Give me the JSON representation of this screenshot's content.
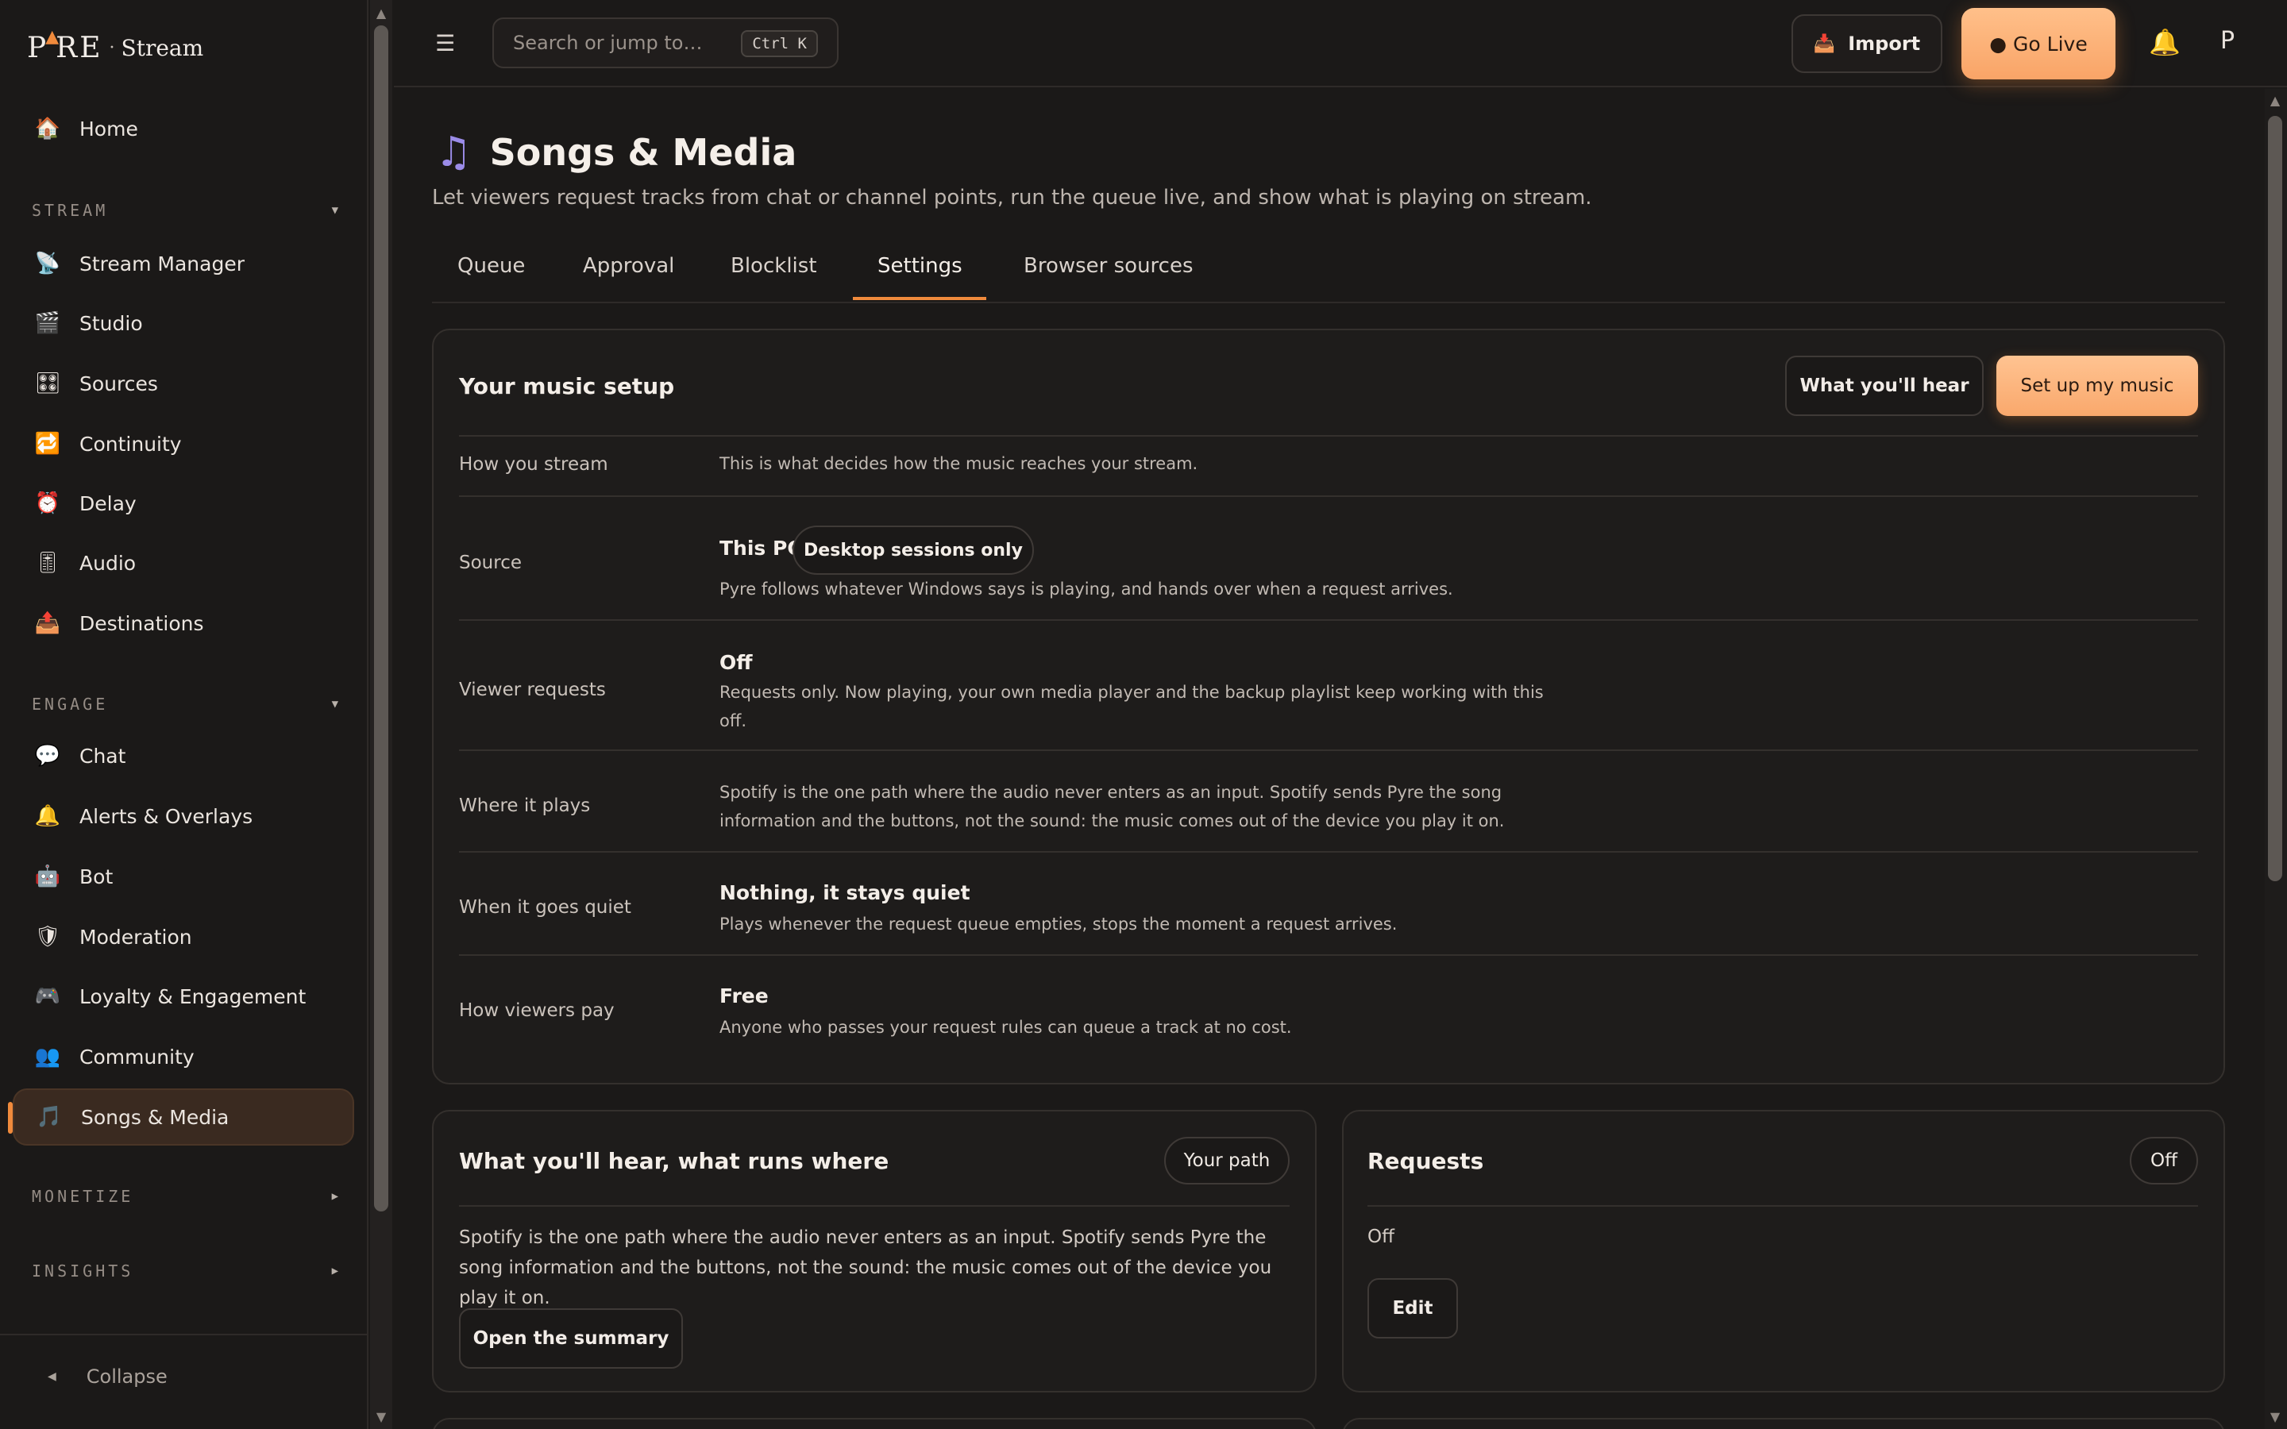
{
  "brand": {
    "name": "PYRE",
    "separator": "·",
    "product": "Stream"
  },
  "sidebar": {
    "home": {
      "label": "Home",
      "icon": "home-icon"
    },
    "sections": {
      "stream": "STREAM",
      "engage": "ENGAGE",
      "monetize": "MONETIZE",
      "insights": "INSIGHTS"
    },
    "stream_items": [
      {
        "label": "Stream Manager",
        "icon": "satellite-dish-icon"
      },
      {
        "label": "Studio",
        "icon": "clapperboard-icon"
      },
      {
        "label": "Sources",
        "icon": "sources-grid-icon"
      },
      {
        "label": "Continuity",
        "icon": "repeat-icon"
      },
      {
        "label": "Delay",
        "icon": "alarm-clock-icon"
      },
      {
        "label": "Audio",
        "icon": "audio-slider-icon"
      },
      {
        "label": "Destinations",
        "icon": "outbox-icon"
      }
    ],
    "engage_items": [
      {
        "label": "Chat",
        "icon": "speech-bubble-icon"
      },
      {
        "label": "Alerts & Overlays",
        "icon": "bell-icon"
      },
      {
        "label": "Bot",
        "icon": "robot-icon"
      },
      {
        "label": "Moderation",
        "icon": "shield-icon"
      },
      {
        "label": "Loyalty & Engagement",
        "icon": "gamepad-icon"
      },
      {
        "label": "Community",
        "icon": "people-icon"
      },
      {
        "label": "Songs & Media",
        "icon": "music-note-icon"
      }
    ],
    "collapse": "Collapse"
  },
  "topbar": {
    "search_placeholder": "Search or jump to…",
    "search_shortcut": "Ctrl K",
    "import_label": "Import",
    "go_live_label": "● Go Live",
    "avatar_initial": "P"
  },
  "page": {
    "title": "Songs & Media",
    "description": "Let viewers request tracks from chat or channel points, run the queue live, and show what is playing on stream.",
    "tabs": [
      "Queue",
      "Approval",
      "Blocklist",
      "Settings",
      "Browser sources"
    ],
    "active_tab": "Settings"
  },
  "setup_card": {
    "title": "Your music setup",
    "what_youll_hear_btn": "What you'll hear",
    "setup_btn": "Set up my music",
    "rows": {
      "how_you_stream": {
        "label": "How you stream",
        "text": "This is what decides how the music reaches your stream."
      },
      "source": {
        "label": "Source",
        "value": "This PC",
        "chip": "Desktop sessions only",
        "text": "Pyre follows whatever Windows says is playing, and hands over when a request arrives."
      },
      "viewer_requests": {
        "label": "Viewer requests",
        "value": "Off",
        "text": "Requests only. Now playing, your own media player and the backup playlist keep working with this off."
      },
      "where_it_plays": {
        "label": "Where it plays",
        "text": "Spotify is the one path where the audio never enters as an input. Spotify sends Pyre the song information and the buttons, not the sound: the music comes out of the device you play it on."
      },
      "when_quiet": {
        "label": "When it goes quiet",
        "value": "Nothing, it stays quiet",
        "text": "Plays whenever the request queue empties, stops the moment a request arrives."
      },
      "how_pay": {
        "label": "How viewers pay",
        "value": "Free",
        "text": "Anyone who passes your request rules can queue a track at no cost."
      }
    }
  },
  "hear_card": {
    "title": "What you'll hear, what runs where",
    "pill": "Your path",
    "text": "Spotify is the one path where the audio never enters as an input. Spotify sends Pyre the song information and the buttons, not the sound: the music comes out of the device you play it on.",
    "button": "Open the summary"
  },
  "requests_card": {
    "title": "Requests",
    "pill": "Off",
    "status": "Off",
    "button": "Edit"
  },
  "colors": {
    "background": "#1b1918",
    "accent": "#f08a3c",
    "primary_button": "#f9a86c",
    "active_nav_bg": "#3a2a20"
  }
}
